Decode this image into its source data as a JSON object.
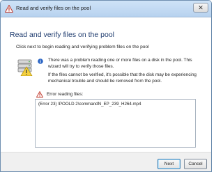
{
  "window": {
    "title": "Read and verify files on the pool",
    "close_label": "✕"
  },
  "main": {
    "heading": "Read and verify files on the pool",
    "subtext": "Click next to begin reading and verifying problem files on the pool",
    "message1": "There was a problem reading one or more files on a disk in the pool. This wizard will try to verify those files.",
    "message2": "If the files cannot be verified, it's possible that the disk may be experiencing mechanical trouble and should be removed from the pool.",
    "error_label": "Error reading files:",
    "errors": [
      "(Error 23) \\POOLD 2\\commandN_EP_239_H264.mp4"
    ]
  },
  "footer": {
    "next_label": "Next",
    "cancel_label": "Cancel"
  },
  "colors": {
    "heading": "#1e3b6e",
    "warning": "#c0392b",
    "info": "#2a64c4"
  },
  "icons": {
    "title": "warning-icon",
    "main": "drive-icon",
    "info": "info-icon",
    "error": "warning-icon"
  }
}
